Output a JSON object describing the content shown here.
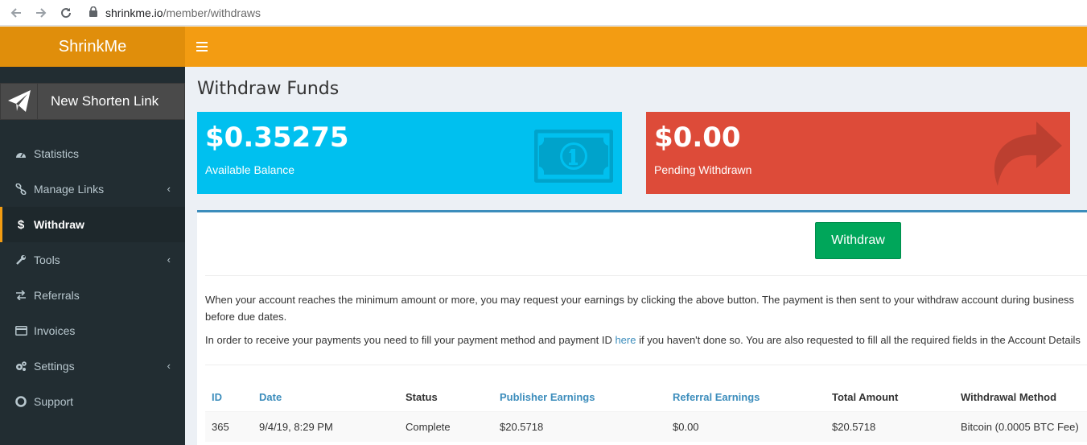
{
  "browser": {
    "url_host": "shrinkme.io",
    "url_path": "/member/withdraws"
  },
  "header": {
    "logo": "ShrinkMe"
  },
  "sidebar": {
    "new_link_label": "New Shorten Link",
    "items": [
      {
        "label": "Statistics",
        "icon": "dashboard-icon"
      },
      {
        "label": "Manage Links",
        "icon": "link-icon",
        "has_submenu": true
      },
      {
        "label": "Withdraw",
        "icon": "dollar-icon",
        "active": true
      },
      {
        "label": "Tools",
        "icon": "wrench-icon",
        "has_submenu": true
      },
      {
        "label": "Referrals",
        "icon": "exchange-icon"
      },
      {
        "label": "Invoices",
        "icon": "credit-card-icon"
      },
      {
        "label": "Settings",
        "icon": "gears-icon",
        "has_submenu": true
      },
      {
        "label": "Support",
        "icon": "life-ring-icon"
      }
    ]
  },
  "main": {
    "title": "Withdraw Funds",
    "available": {
      "value": "$0.35275",
      "label": "Available Balance",
      "color": "#00c0ef",
      "icon": "money-icon"
    },
    "pending": {
      "value": "$0.00",
      "label": "Pending Withdrawn",
      "color": "#dd4b39",
      "icon": "share-arrow-icon"
    },
    "withdraw_button": "Withdraw",
    "info_para1": "When your account reaches the minimum amount or more, you may request your earnings by clicking the above button. The payment is then sent to your withdraw account during business",
    "info_para1_line2": "before due dates.",
    "info_para2_pre": "In order to receive your payments you need to fill your payment method and payment ID ",
    "info_para2_link": "here",
    "info_para2_post": " if you haven't done so. You are also requested to fill all the required fields in the Account Details",
    "table": {
      "headers": [
        "ID",
        "Date",
        "Status",
        "Publisher Earnings",
        "Referral Earnings",
        "Total Amount",
        "Withdrawal Method"
      ],
      "rows": [
        [
          "365",
          "9/4/19, 8:29 PM",
          "Complete",
          "$20.5718",
          "$0.00",
          "$20.5718",
          "Bitcoin (0.0005 BTC Fee)"
        ]
      ]
    }
  }
}
